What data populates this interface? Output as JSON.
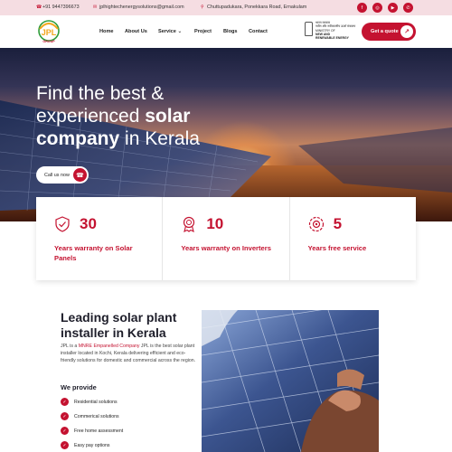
{
  "topbar": {
    "phone": "+91 9447396673",
    "email": "jplhightechenergysolutions@gmail.com",
    "address": "Chuttupadukara, Ponekkara Road, Ernakulam",
    "social_icons": [
      "facebook-icon",
      "instagram-icon",
      "youtube-icon",
      "whatsapp-icon"
    ]
  },
  "header": {
    "logo_text": "JPL",
    "logo_sub": "GROUP",
    "nav": [
      "Home",
      "About Us",
      "Service",
      "Project",
      "Blogs",
      "Contact"
    ],
    "service_caret": "⌄",
    "gov_line1": "भारत सरकार",
    "gov_line2": "नवीन और नवीकरणीय ऊर्जा मंत्रालय",
    "gov_line3": "MINISTRY OF",
    "gov_line4": "NEW AND",
    "gov_line5": "RENEWABLE ENERGY",
    "quote_label": "Get a quote",
    "quote_arrow": "↗"
  },
  "hero": {
    "line1": "Find the best &",
    "line2a": "experienced ",
    "line2b": "solar",
    "line3a": "company",
    "line3b": " in Kerala",
    "call_label": "Call us now",
    "call_icon": "phone-icon"
  },
  "stats": [
    {
      "icon": "shield-warranty-icon",
      "number": "30",
      "label": "Years warranty on Solar Panels"
    },
    {
      "icon": "medal-icon",
      "number": "10",
      "label": "Years warranty on Inverters"
    },
    {
      "icon": "service-gear-icon",
      "number": "5",
      "label": "Years free service"
    }
  ],
  "about": {
    "title": "Leading solar plant installer in Kerala",
    "p_pre": "JPL is a ",
    "p_mnre": "MNRE",
    "p_mid": " ",
    "p_emp": "Empanelled Company",
    "p_post": " JPL is the best solar plant installer located in Kochi, Kerala delivering efficient and eco-friendly solutions for domestic and commercial across the region.",
    "we_provide": "We provide",
    "items": [
      "Residential solutions",
      "Commerical solutions",
      "Free home assessment",
      "Easy pay options"
    ],
    "check": "✓"
  },
  "colors": {
    "accent": "#c41230",
    "topbar_bg": "#f5dde2",
    "dark_text": "#1e1e2a"
  }
}
